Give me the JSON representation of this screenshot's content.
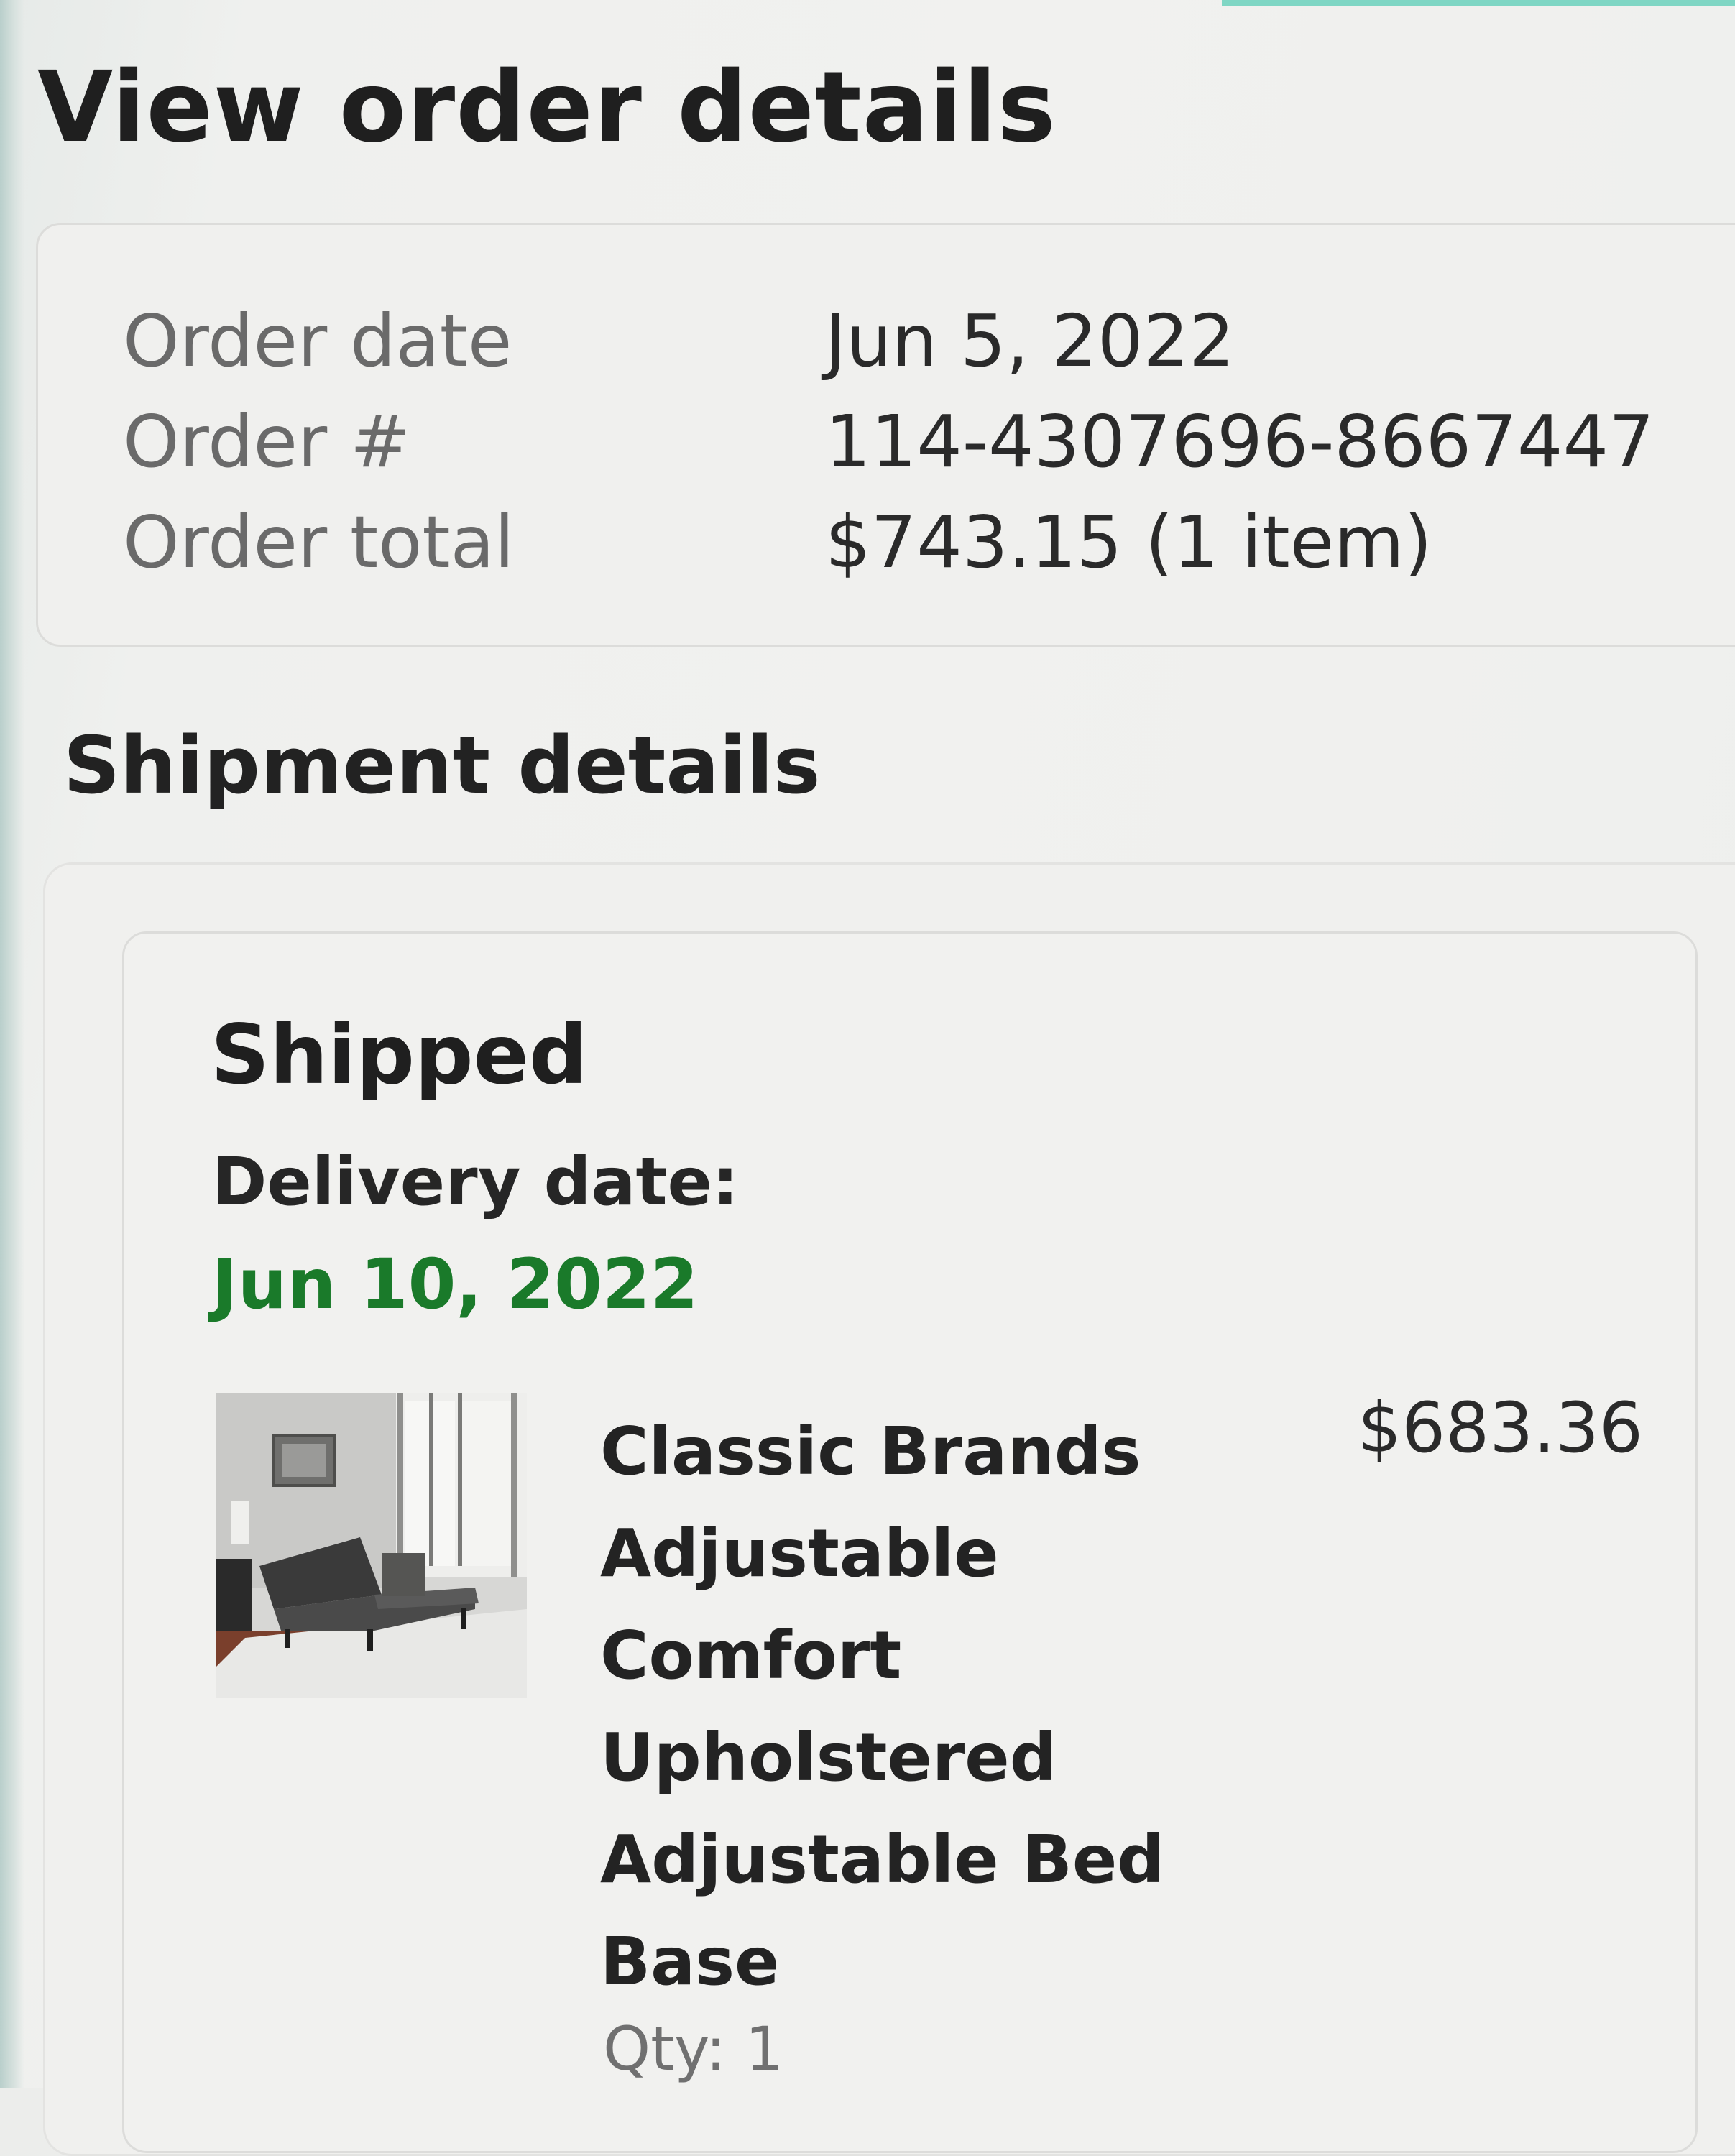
{
  "page": {
    "title": "View order details"
  },
  "order_summary": {
    "rows": [
      {
        "label": "Order date",
        "value": "Jun 5, 2022"
      },
      {
        "label": "Order #",
        "value": "114-4307696-8667447"
      },
      {
        "label": "Order total",
        "value": "$743.15 (1 item)"
      }
    ]
  },
  "shipment": {
    "section_title": "Shipment details",
    "status": "Shipped",
    "delivery_label": "Delivery date:",
    "delivery_date": "Jun 10, 2022",
    "item": {
      "name": "Classic Brands\nAdjustable\nComfort\nUpholstered\nAdjustable Bed\nBase",
      "price": "$683.36",
      "quantity": "Qty: 1",
      "image_icon": "bedroom-product-photo"
    }
  },
  "colors": {
    "accent_green": "#1a7a2a",
    "muted_label": "#6a6a6a",
    "heading": "#1f1f1f",
    "top_edge": "#7fd6c4"
  }
}
